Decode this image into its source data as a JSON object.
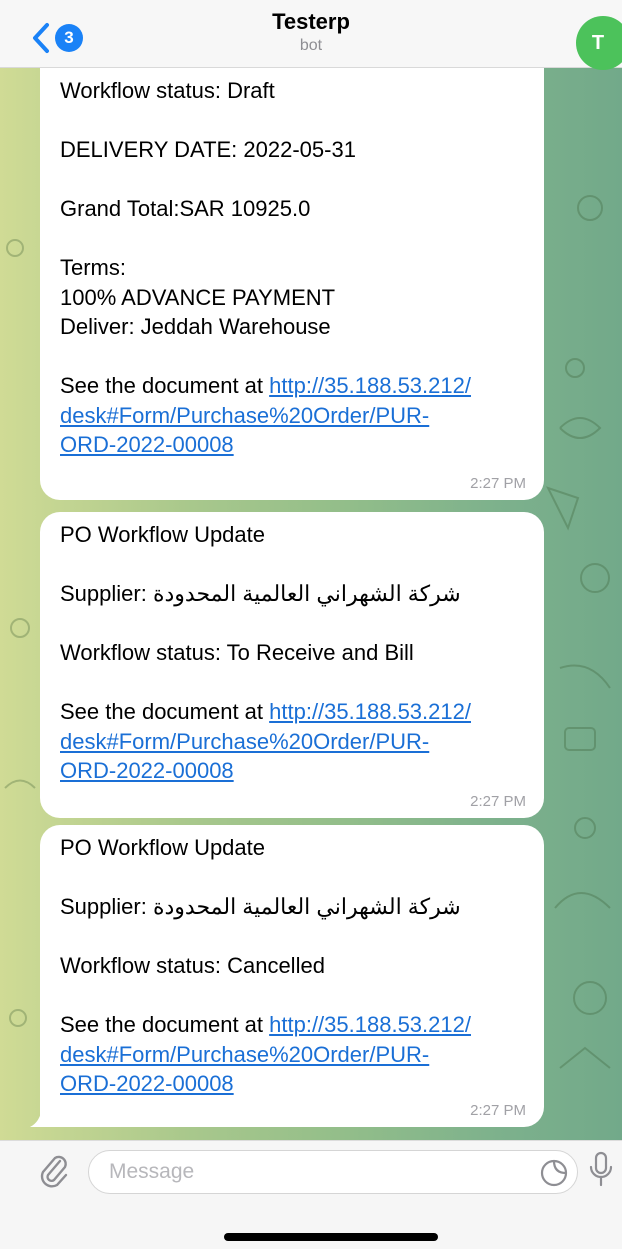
{
  "header": {
    "back_badge": "3",
    "title": "Testerp",
    "subtitle": "bot",
    "avatar_initial": "T"
  },
  "messages": [
    {
      "lines": [
        "Workflow status: Draft",
        "",
        "DELIVERY DATE: 2022-05-31",
        "",
        "Grand Total:SAR 10925.0",
        "",
        "Terms:",
        "100% ADVANCE PAYMENT",
        "Deliver: Jeddah Warehouse",
        ""
      ],
      "link_prefix": "See the document at ",
      "link_line1": "http://35.188.53.212/",
      "link_line2": "desk#Form/Purchase%20Order/PUR-",
      "link_line3": "ORD-2022-00008",
      "time": "2:27 PM"
    },
    {
      "lines": [
        "PO Workflow Update",
        "",
        "Supplier: شركة الشهراني العالمية المحدودة",
        "",
        "Workflow status: To Receive and Bill",
        ""
      ],
      "link_prefix": "See the document at ",
      "link_line1": "http://35.188.53.212/",
      "link_line2": "desk#Form/Purchase%20Order/PUR-",
      "link_line3": "ORD-2022-00008",
      "time": "2:27 PM"
    },
    {
      "lines": [
        "PO Workflow Update",
        "",
        "Supplier: شركة الشهراني العالمية المحدودة",
        "",
        "Workflow status: Cancelled",
        ""
      ],
      "link_prefix": "See the document at ",
      "link_line1": "http://35.188.53.212/",
      "link_line2": "desk#Form/Purchase%20Order/PUR-",
      "link_line3": "ORD-2022-00008",
      "time": "2:27 PM"
    }
  ],
  "composer": {
    "placeholder": "Message"
  },
  "icons": {
    "back": "chevron-left-icon",
    "attach": "paperclip-icon",
    "sticker": "sticker-icon",
    "mic": "microphone-icon"
  },
  "colors": {
    "accent": "#1a82f7",
    "link": "#1a6fd6",
    "avatar": "#4cc25b",
    "bubble": "#ffffff"
  }
}
